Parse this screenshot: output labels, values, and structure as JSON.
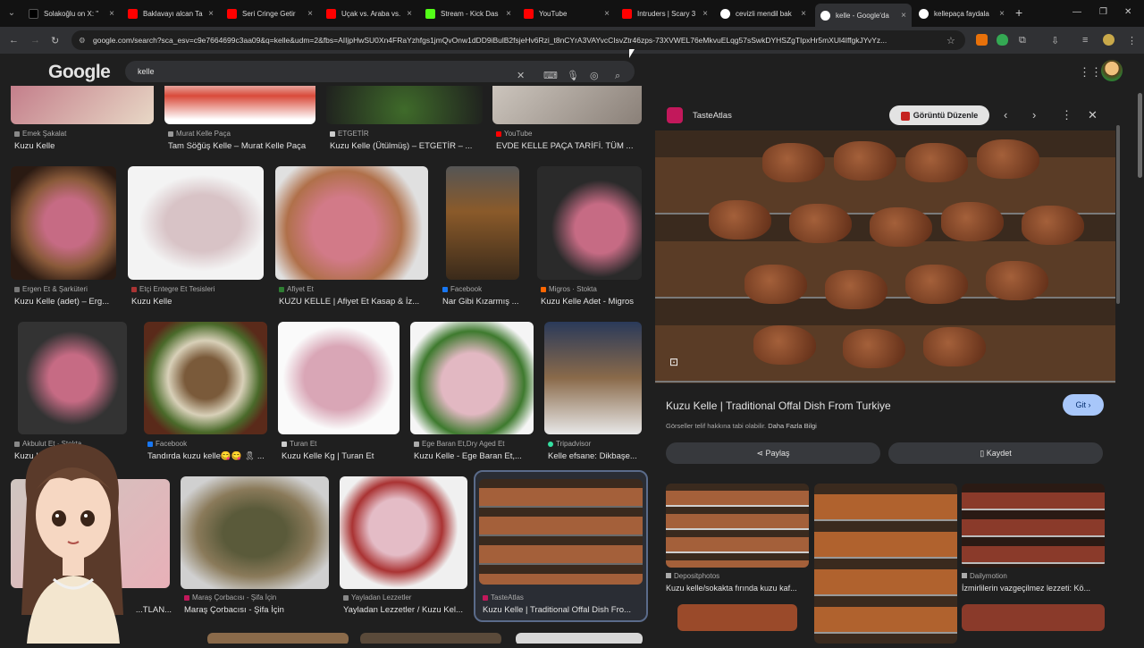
{
  "tabs": [
    {
      "label": "Solakoğlu on X: \"",
      "color": "#000000"
    },
    {
      "label": "Baklavayı alcan Ta",
      "color": "#ff0000"
    },
    {
      "label": "Seri Cringe Getir",
      "color": "#ff0000"
    },
    {
      "label": "Uçak vs. Araba vs.",
      "color": "#ff0000"
    },
    {
      "label": "Stream - Kick Das",
      "color": "#53fc18"
    },
    {
      "label": "YouTube",
      "color": "#ff0000"
    },
    {
      "label": "Intruders | Scary 3",
      "color": "#ff0000"
    },
    {
      "label": "cevizli mendil bak",
      "color": "#4285f4"
    },
    {
      "label": "kelle - Google'da",
      "color": "#4285f4"
    },
    {
      "label": "kellepaça faydala",
      "color": "#4285f4"
    }
  ],
  "address": {
    "url": "google.com/search?sca_esv=c9e7664699c3aa09&q=kelle&udm=2&fbs=AIIjpHwSU0Xn4FRaYzhfgs1jmQvOnw1dDD9iBulB2fsjeHv6Rzi_t8nCYrA3VAYvcCIsvZtr46zps-73XVWEL76eMkvuELqg57sSwkDYHSZgTIpxHr5mXUl4IffgkJYvYz..."
  },
  "header": {
    "logo": "Google",
    "query": "kelle"
  },
  "grid": {
    "row0": [
      {
        "source": "Emek Şakalat",
        "caption": "Kuzu Kelle"
      },
      {
        "source": "Murat Kelle Paça",
        "caption": "Tam Söğüş Kelle – Murat Kelle Paça"
      },
      {
        "source": "ETGETİR",
        "caption": "Kuzu Kelle (Ütülmüş) – ETGETİR – ..."
      },
      {
        "source": "YouTube",
        "caption": "EVDE KELLE PAÇA TARİFİ. TÜM ..."
      }
    ],
    "row1": [
      {
        "source": "Ergen Et & Şarküteri",
        "caption": "Kuzu Kelle (adet) – Erg..."
      },
      {
        "source": "Etçi Entegre Et Tesisleri",
        "caption": "Kuzu Kelle"
      },
      {
        "source": "Afiyet Et",
        "caption": "KUZU KELLE | Afiyet Et Kasap & İz..."
      },
      {
        "source": "Facebook",
        "caption": "Nar Gibi Kızarmış ..."
      },
      {
        "source": "Migros · Stokta",
        "caption": "Kuzu Kelle Adet - Migros"
      }
    ],
    "row2": [
      {
        "source": "Akbulut Et · Stokta",
        "caption": "Kuzu Kelle | Akbulut Et..."
      },
      {
        "source": "Facebook",
        "caption": "Tandırda kuzu kelle😋😋 🎗 ..."
      },
      {
        "source": "Turan Et",
        "caption": "Kuzu Kelle Kg | Turan Et"
      },
      {
        "source": "Ege Baran Et,Dry Aged Et",
        "caption": "Kuzu Kelle - Ege Baran Et,..."
      },
      {
        "source": "Tripadvisor",
        "caption": "Kelle efsane: Dikbaşe..."
      }
    ],
    "row3": [
      {
        "source": "",
        "caption": "...TLAN..."
      },
      {
        "source": "Maraş Çorbacısı - Şifa İçin",
        "caption": "Maraş Çorbacısı - Şifa İçin"
      },
      {
        "source": "Yayladan Lezzetler",
        "caption": "Yayladan Lezzetler / Kuzu Kel..."
      },
      {
        "source": "TasteAtlas",
        "caption": "Kuzu Kelle | Traditional Offal Dish Fro..."
      }
    ]
  },
  "panel": {
    "source": "TasteAtlas",
    "edit_button": "Görüntü Düzenle",
    "title": "Kuzu Kelle | Traditional Offal Dish From Turkiye",
    "visit": "Git",
    "copyright": "Görseller telif hakkına tabi olabilir.",
    "more_info": "Daha Fazla Bilgi",
    "share": "Paylaş",
    "save": "Kaydet",
    "related": [
      {
        "source": "Depositphotos",
        "caption": "Kuzu kelle/sokakta fırında kuzu kaf..."
      },
      {
        "source": "",
        "caption": ""
      },
      {
        "source": "Dailymotion",
        "caption": "İzmirlilerin vazgeçilmez lezzeti: Kö..."
      }
    ]
  },
  "colors": {
    "accent": "#a8c7fa",
    "bg": "#1f1f1f",
    "meat": "#c66b84"
  }
}
